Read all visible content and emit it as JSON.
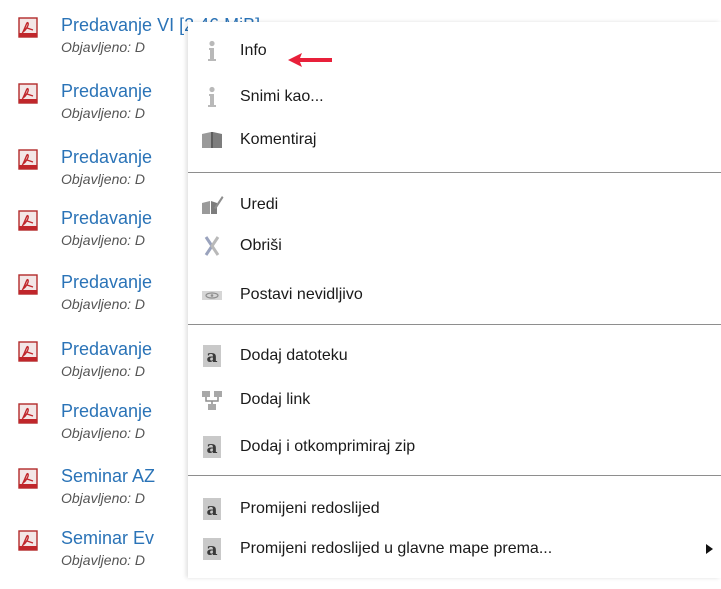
{
  "colors": {
    "link": "#2a73b7",
    "pointer_arrow": "#e8203a",
    "separator": "#8e8e8e"
  },
  "file_list": {
    "items": [
      {
        "title": "Predavanje VI [2.46 MiB]",
        "published": "Objavljeno: D",
        "icon": "pdf-file-icon"
      },
      {
        "title": "Predavanje",
        "published": "Objavljeno: D",
        "icon": "pdf-file-icon"
      },
      {
        "title": "Predavanje",
        "published": "Objavljeno: D",
        "icon": "pdf-file-icon"
      },
      {
        "title": "Predavanje",
        "published": "Objavljeno: D",
        "icon": "pdf-file-icon"
      },
      {
        "title": "Predavanje",
        "published": "Objavljeno: D",
        "icon": "pdf-file-icon"
      },
      {
        "title": "Predavanje",
        "published": "Objavljeno: D",
        "icon": "pdf-file-icon"
      },
      {
        "title": "Predavanje",
        "published": "Objavljeno: D",
        "icon": "pdf-file-icon"
      },
      {
        "title": "Seminar AZ",
        "published": "Objavljeno: D",
        "icon": "pdf-file-icon"
      },
      {
        "title": "Seminar Ev",
        "published": "Objavljeno: D",
        "icon": "pdf-file-icon"
      }
    ]
  },
  "context_menu": {
    "items": [
      {
        "label": "Info",
        "icon": "info-icon",
        "highlighted_by_arrow": true
      },
      {
        "label": "Snimi kao...",
        "icon": "info-icon"
      },
      {
        "label": "Komentiraj",
        "icon": "open-book-icon"
      },
      {
        "label": "Uredi",
        "icon": "edit-book-icon"
      },
      {
        "label": "Obriši",
        "icon": "delete-icon"
      },
      {
        "label": "Postavi nevidljivo",
        "icon": "hidden-eye-icon"
      },
      {
        "label": "Dodaj datoteku",
        "icon": "file-a-icon"
      },
      {
        "label": "Dodaj link",
        "icon": "network-link-icon"
      },
      {
        "label": "Dodaj i otkomprimiraj zip",
        "icon": "file-a-icon"
      },
      {
        "label": "Promijeni redoslijed",
        "icon": "file-a-icon"
      },
      {
        "label": "Promijeni redoslijed u glavne mape prema...",
        "icon": "file-a-icon",
        "has_submenu": true
      }
    ]
  }
}
